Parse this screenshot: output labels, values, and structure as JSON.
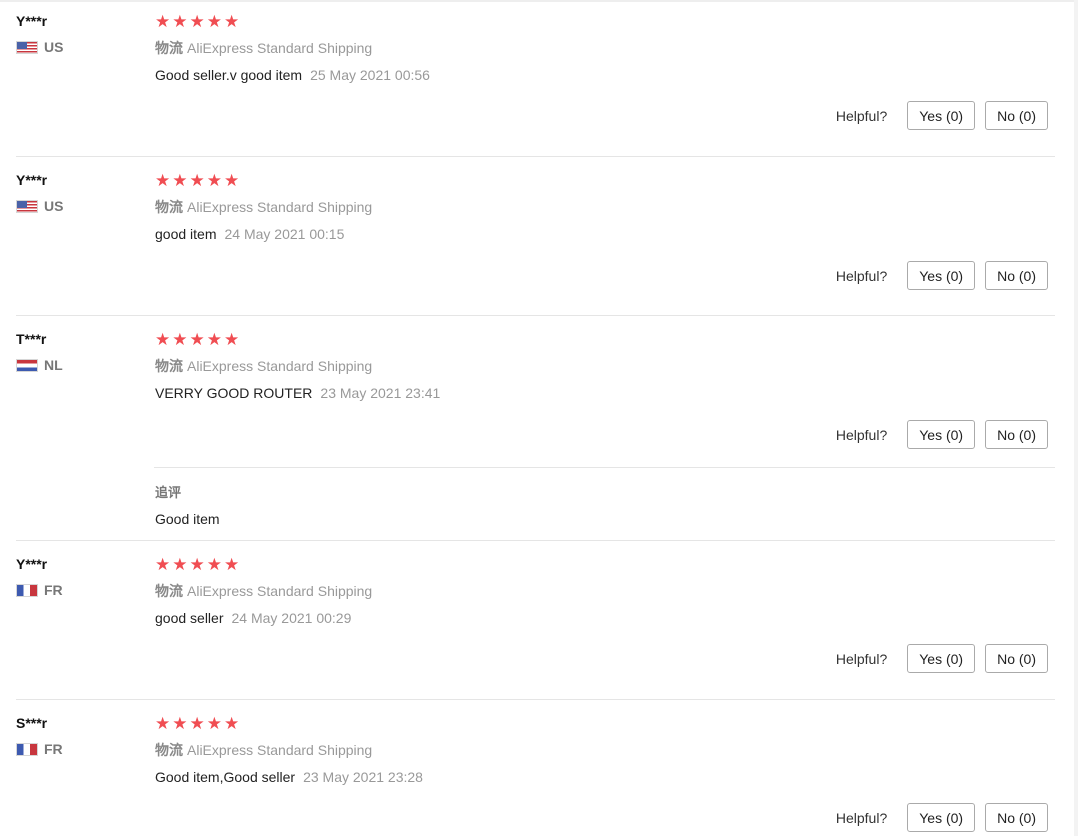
{
  "helpful_label": "Helpful?",
  "star_color": "#f04d52",
  "reviews": [
    {
      "user": "Y***r",
      "country": "US",
      "flag": "us",
      "stars": 5,
      "shipping_label": "物流",
      "shipping": "AliExpress Standard Shipping",
      "text": "Good seller.v good item",
      "date": "25 May 2021 00:56",
      "yes": "Yes (0)",
      "no": "No (0)"
    },
    {
      "user": "Y***r",
      "country": "US",
      "flag": "us",
      "stars": 5,
      "shipping_label": "物流",
      "shipping": "AliExpress Standard Shipping",
      "text": "good item",
      "date": "24 May 2021 00:15",
      "yes": "Yes (0)",
      "no": "No (0)"
    },
    {
      "user": "T***r",
      "country": "NL",
      "flag": "nl",
      "stars": 5,
      "shipping_label": "物流",
      "shipping": "AliExpress Standard Shipping",
      "text": "VERRY GOOD ROUTER",
      "date": "23 May 2021 23:41",
      "yes": "Yes (0)",
      "no": "No (0)",
      "followup_label": "追评",
      "followup_text": "Good item"
    },
    {
      "user": "Y***r",
      "country": "FR",
      "flag": "fr",
      "stars": 5,
      "shipping_label": "物流",
      "shipping": "AliExpress Standard Shipping",
      "text": "good seller",
      "date": "24 May 2021 00:29",
      "yes": "Yes (0)",
      "no": "No (0)"
    },
    {
      "user": "S***r",
      "country": "FR",
      "flag": "fr",
      "stars": 5,
      "shipping_label": "物流",
      "shipping": "AliExpress Standard Shipping",
      "text": "Good item,Good seller",
      "date": "23 May 2021 23:28",
      "yes": "Yes (0)",
      "no": "No (0)"
    }
  ]
}
